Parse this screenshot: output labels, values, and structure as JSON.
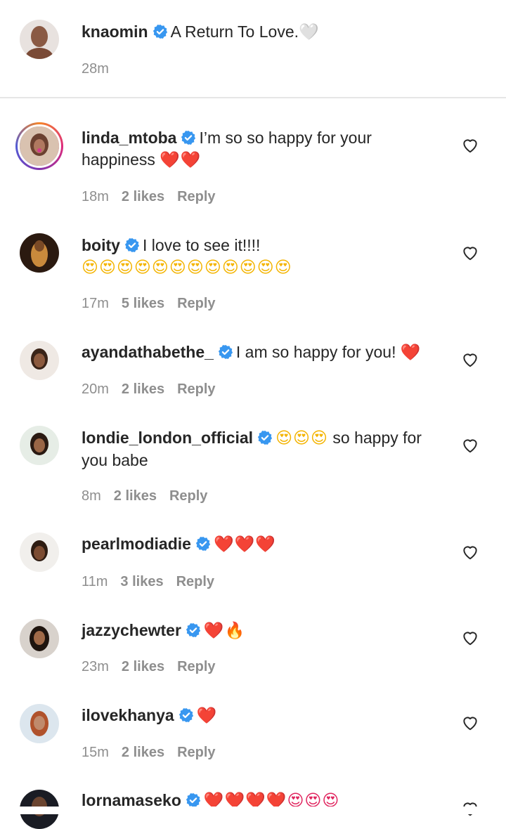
{
  "caption": {
    "username": "knaomin",
    "text": "A Return To Love.",
    "emoji": "🤍",
    "time": "28m"
  },
  "comments": [
    {
      "username": "linda_mtoba",
      "text": "I’m so so happy for your happiness",
      "emoji": "❤️❤️",
      "time": "18m",
      "likes": "2 likes",
      "reply": "Reply"
    },
    {
      "username": "boity",
      "text": "I love to see it!!!!",
      "emoji": "😍😍😍😍😍😍😍😍😍😍😍😍",
      "time": "17m",
      "likes": "5 likes",
      "reply": "Reply"
    },
    {
      "username": "ayandathabethe_",
      "text": "I am so happy for you!",
      "emoji": "❤️",
      "time": "20m",
      "likes": "2 likes",
      "reply": "Reply"
    },
    {
      "username": "londie_london_official",
      "emoji": "😍😍😍",
      "text": "so happy for you babe",
      "time": "8m",
      "likes": "2 likes",
      "reply": "Reply"
    },
    {
      "username": "pearlmodiadie",
      "text": "",
      "emoji": "❤️❤️❤️",
      "time": "11m",
      "likes": "3 likes",
      "reply": "Reply"
    },
    {
      "username": "jazzychewter",
      "text": "",
      "emoji": "❤️🔥",
      "time": "23m",
      "likes": "2 likes",
      "reply": "Reply"
    },
    {
      "username": "ilovekhanya",
      "text": "",
      "emoji": "❤️",
      "time": "15m",
      "likes": "2 likes",
      "reply": "Reply"
    },
    {
      "username": "lornamaseko",
      "text": "",
      "emoji": "❤️❤️❤️❤️😍😍😍"
    }
  ],
  "icons": {
    "verified": "verified-badge-icon",
    "like": "heart-outline-icon"
  },
  "colors": {
    "verified_blue": "#3897f0",
    "meta_gray": "#8e8e8e",
    "text": "#262626"
  }
}
